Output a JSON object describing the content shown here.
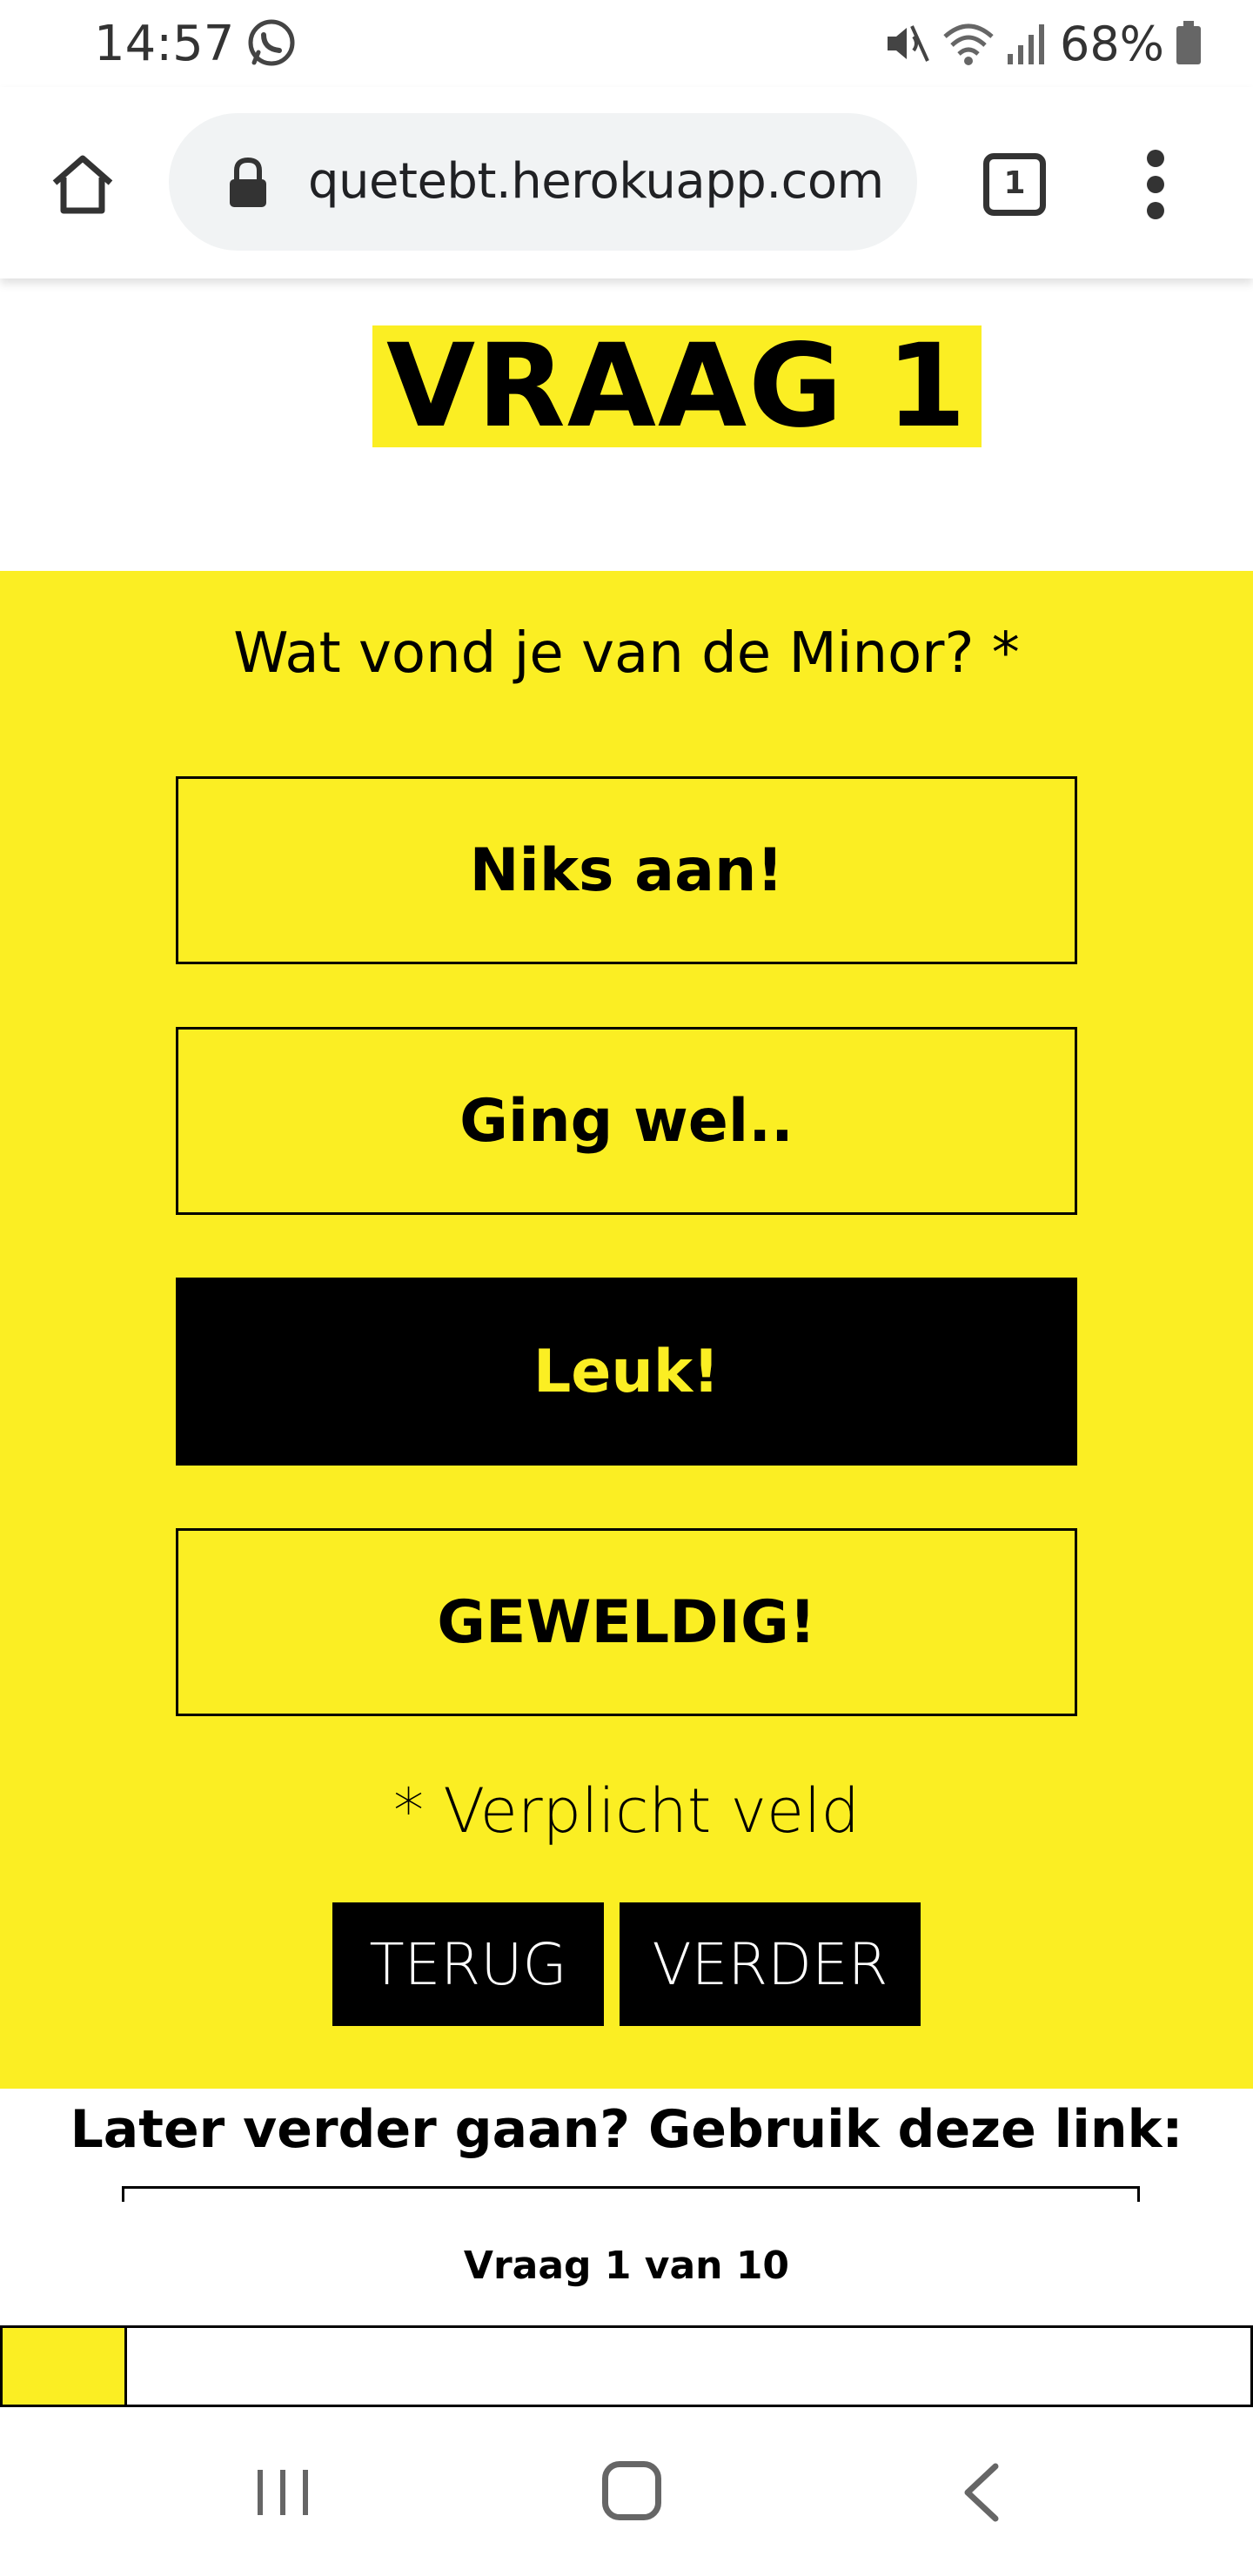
{
  "status_bar": {
    "time": "14:57",
    "battery": "68%",
    "icons": [
      "whatsapp-icon",
      "mute-icon",
      "wifi-icon",
      "signal-icon",
      "battery-icon"
    ]
  },
  "browser": {
    "url": "quetebt.herokuapp.com",
    "tab_count": "1"
  },
  "page": {
    "title": "VRAAG 1",
    "question": "Wat vond je van de Minor? *",
    "options": [
      {
        "label": "Niks aan!",
        "selected": false
      },
      {
        "label": "Ging wel..",
        "selected": false
      },
      {
        "label": "Leuk!",
        "selected": true
      },
      {
        "label": "GEWELDIG!",
        "selected": false
      }
    ],
    "required_note": "* Verplicht veld",
    "back_button": "TERUG",
    "next_button": "VERDER",
    "later_text": "Later verder gaan? Gebruik deze link:"
  },
  "progress": {
    "label": "Vraag 1 van 10",
    "current": 1,
    "total": 10
  },
  "colors": {
    "accent": "#fbee23",
    "dark": "#000000"
  }
}
